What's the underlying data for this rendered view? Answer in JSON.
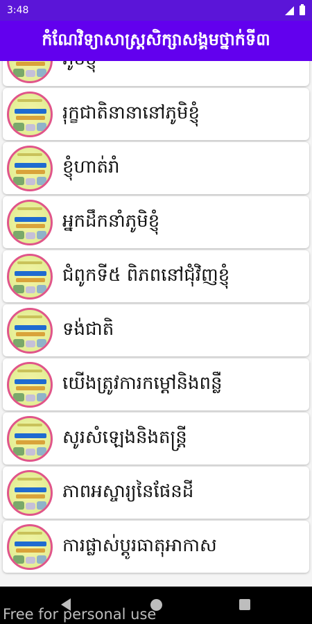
{
  "status_bar": {
    "time": "3:48",
    "icons": [
      "signal-icon",
      "battery-icon"
    ]
  },
  "app_bar": {
    "title": "កំណែវិទ្យាសាស្ត្រសិក្សាសង្គមថ្នាក់ទី៣"
  },
  "lessons": [
    {
      "title": "ភូមិខ្ញុំ"
    },
    {
      "title": "រុក្ខជាតិនានានៅភូមិខ្ញុំ"
    },
    {
      "title": "ខ្ញុំហាត់រាំ"
    },
    {
      "title": "អ្នកដឹកនាំភូមិខ្ញុំ"
    },
    {
      "title": "ជំពូកទី៥ ពិភពនៅជុំវិញខ្ញុំ"
    },
    {
      "title": "ទង់ជាតិ"
    },
    {
      "title": "យើងត្រូវការកម្ដៅនិងពន្លឺ"
    },
    {
      "title": "សូរសំឡេងនិងតន្ត្រី"
    },
    {
      "title": "ភាពអស្ចារ្យនៃផែនដី"
    },
    {
      "title": "ការផ្លាស់ប្ដូរធាតុអាកាស"
    }
  ],
  "nav_bar": {
    "buttons": [
      "back-icon",
      "home-icon",
      "recents-icon"
    ]
  },
  "watermark": "Free for personal use",
  "colors": {
    "status_bar": "#5b15d8",
    "app_bar": "#6200ee",
    "thumbnail_border": "#e0558a"
  }
}
